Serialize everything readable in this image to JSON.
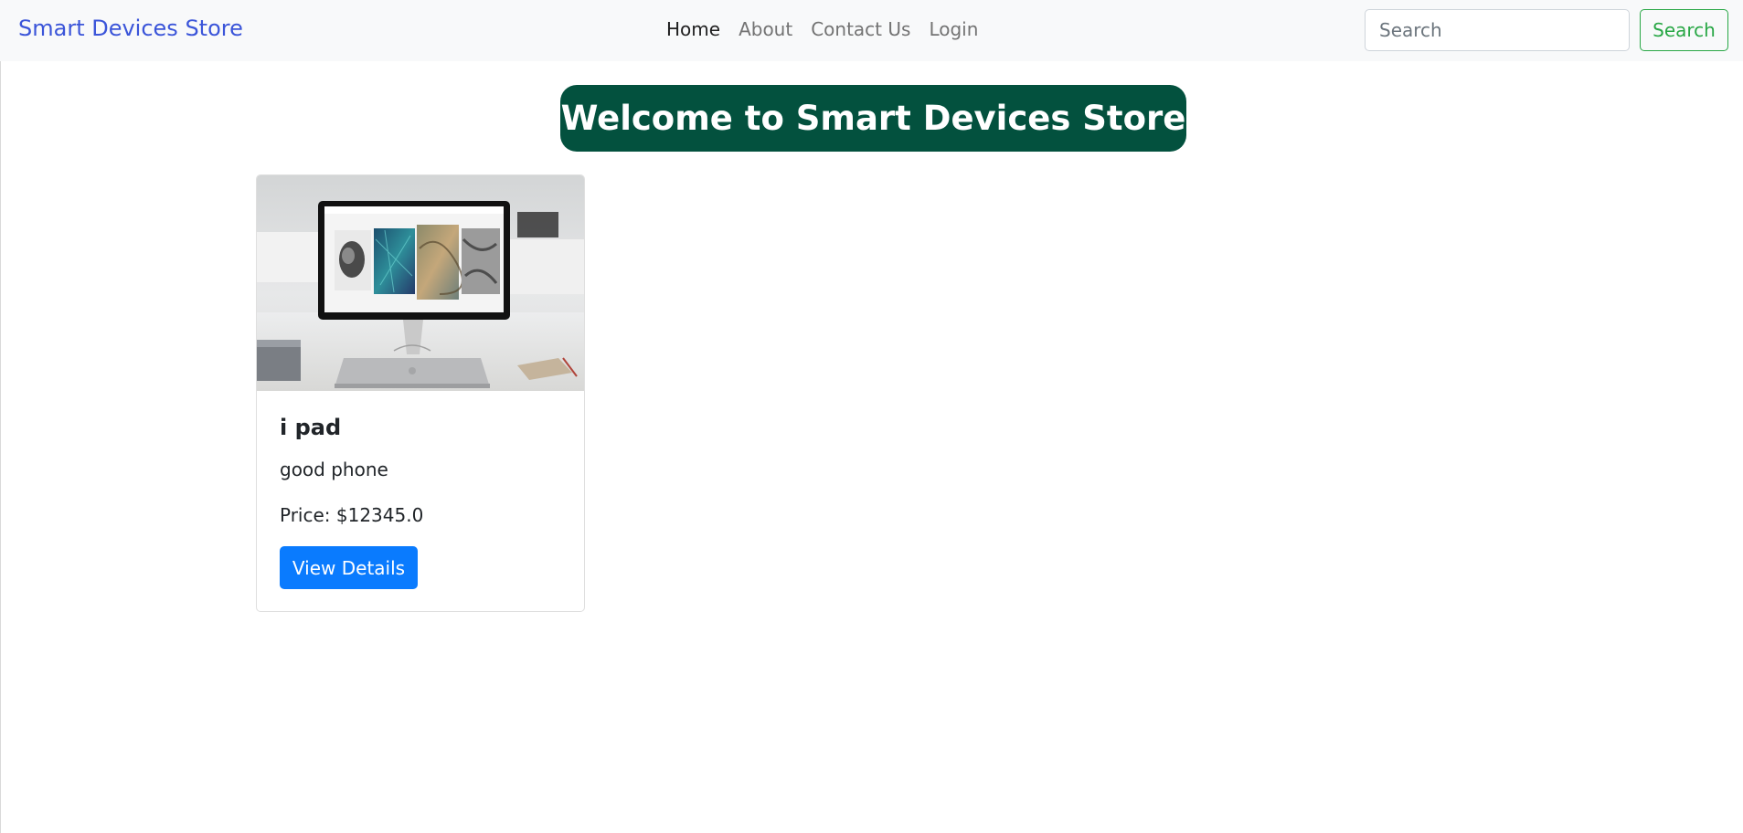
{
  "colors": {
    "navbar_bg": "#f8f9fa",
    "brand": "#3b55d9",
    "search_button": "#28a745",
    "welcome_bg": "#03513e",
    "view_button_bg": "#0a7bfe"
  },
  "navbar": {
    "brand": "Smart Devices Store",
    "links": [
      {
        "label": "Home",
        "active": true
      },
      {
        "label": "About",
        "active": false
      },
      {
        "label": "Contact Us",
        "active": false
      },
      {
        "label": "Login",
        "active": false
      }
    ],
    "search": {
      "placeholder": "Search",
      "value": "",
      "button_label": "Search"
    }
  },
  "main": {
    "welcome": "Welcome to Smart Devices Store",
    "products": [
      {
        "image": "monitor-on-desk-photo",
        "title": "i pad",
        "description": "good phone",
        "price_label": "Price: $",
        "price": "12345.0",
        "button_label": "View Details"
      }
    ]
  }
}
